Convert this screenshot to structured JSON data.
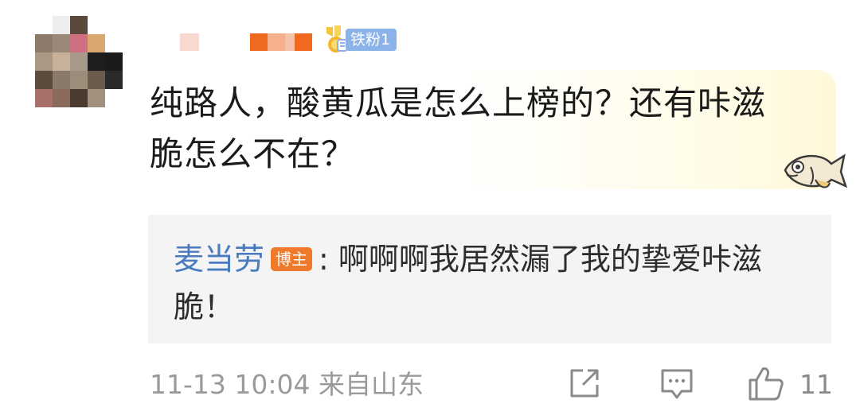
{
  "comment": {
    "fan_badge_label": "铁粉1",
    "text_line1": "纯路人，酸黄瓜是怎么上榜的？还有咔滋",
    "text_line2": "脆怎么不在？"
  },
  "reply": {
    "author": "麦当劳",
    "host_badge": "博主",
    "separator": ":",
    "text_line1": "啊啊啊我居然漏了我的挚爱咔滋",
    "text_line2": "脆！"
  },
  "footer": {
    "timestamp": "11-13 10:04",
    "source": "来自山东",
    "like_count": "11"
  },
  "icons": {
    "share": "share-icon",
    "comment": "comment-icon",
    "like": "like-icon",
    "fan_medal": "fan-medal-icon",
    "sticker": "fish-sticker-icon"
  },
  "colors": {
    "reply_author": "#4a7bc0",
    "host_badge": "#ef7a2b",
    "fan_badge": "#8cb2ea",
    "meta_text": "#9a9a9a",
    "reply_bg": "#f4f4f4"
  }
}
